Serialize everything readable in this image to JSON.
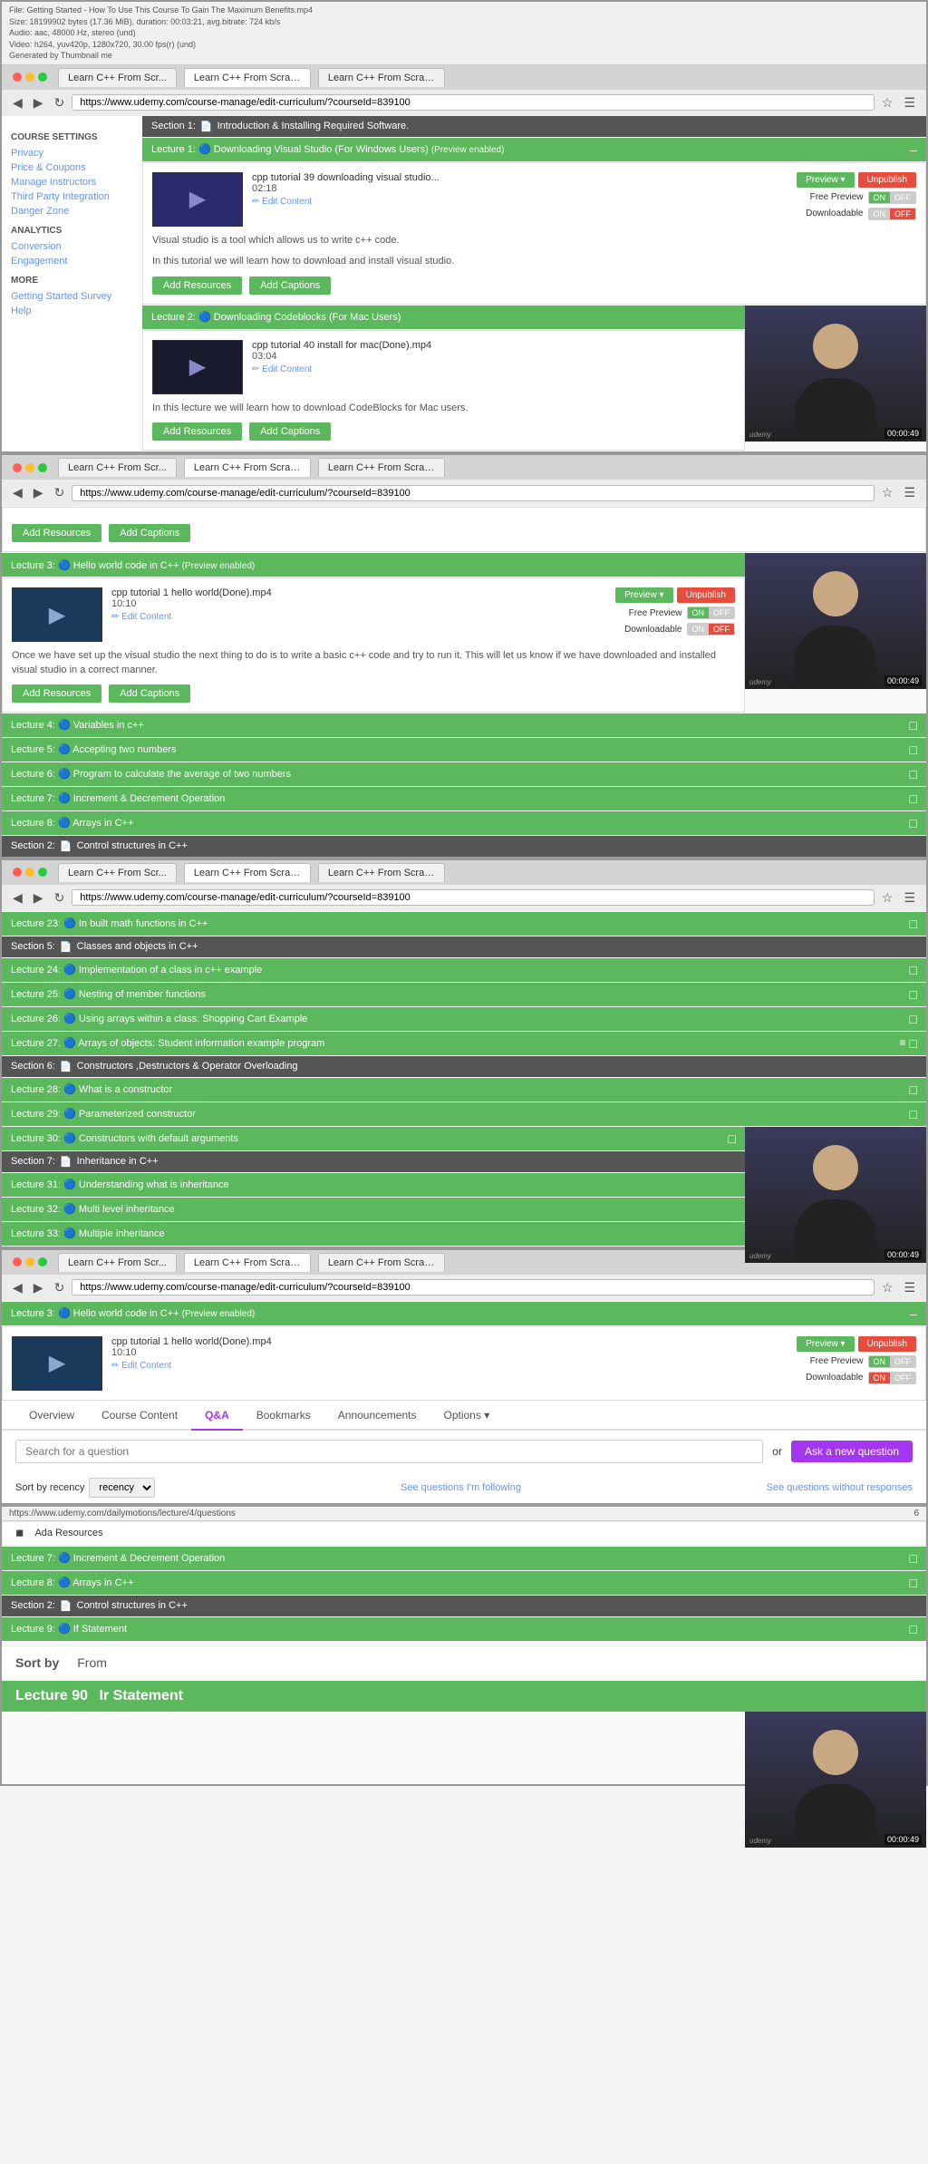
{
  "browser1": {
    "tabs": [
      {
        "label": "Learn C++ From Scr...",
        "active": false
      },
      {
        "label": "Learn C++ From Scratch",
        "active": true
      },
      {
        "label": "Learn C++ From Scratch...",
        "active": false
      }
    ],
    "url": "https://www.udemy.com/course-manage/edit-curriculum/?courseId=839100",
    "title_bar": "File: Getting Started - How To Use This Course To Gain The Maximum Benefits.mp4\nSize: 18199902 bytes (17.36 MiB), duration: 00:03:21, avg.bitrate: 724 kb/s\nAudio: aac, 48000 Hz, stereo (und)\nVideo: h264, yuv420p, 1280x720, 30.00 fps(r) (und)\nGenerated by Thumbnail me"
  },
  "sidebar": {
    "course_settings_title": "COURSE SETTINGS",
    "privacy_link": "Privacy",
    "price_coupons_link": "Price & Coupons",
    "manage_instructors_link": "Manage Instructors",
    "third_party_link": "Third Party Integration",
    "danger_zone_link": "Danger Zone",
    "analytics_title": "ANALYTICS",
    "conversion_link": "Conversion",
    "engagement_link": "Engagement",
    "more_title": "MORE",
    "getting_started_link": "Getting Started Survey",
    "help_link": "Help"
  },
  "section1": {
    "label": "Section 1:",
    "icon": "📄",
    "title": "Introduction & Installing Required Software.",
    "lectures": [
      {
        "number": "Lecture 1:",
        "icon": "🔵",
        "title": "Downloading Visual Studio (For Windows Users)",
        "badge": "(Preview enabled)",
        "filename": "cpp tutorial 39 downloading visual studio...",
        "duration": "02:18",
        "edit_label": "✏ Edit Content",
        "preview_label": "Preview ▾",
        "unpublish_label": "Unpublish",
        "free_preview": "Free Preview",
        "downloadable": "Downloadable",
        "toggle_on": "ON",
        "toggle_off": "OFF",
        "description1": "Visual studio is a tool which allows us to write c++ code.",
        "description2": "In this tutorial we will learn how to download and install visual studio.",
        "add_resources": "Add Resources",
        "add_captions": "Add Captions"
      },
      {
        "number": "Lecture 2:",
        "icon": "🔵",
        "title": "Downloading Codeblocks (For Mac Users)",
        "filename": "cpp tutorial 40 install for mac(Done).mp4",
        "duration": "03:04",
        "edit_label": "✏ Edit Content",
        "description1": "In this lecture we will learn how to download CodeBlocks for Mac users.",
        "add_resources": "Add Resources",
        "add_captions": "Add Captions"
      }
    ]
  },
  "section1_cont": {
    "add_resources": "Add Resources",
    "add_captions": "Add Captions",
    "lecture3": {
      "number": "Lecture 3:",
      "icon": "🔵",
      "title": "Hello world code in C++",
      "badge": "(Preview enabled)",
      "filename": "cpp tutorial 1 hello world(Done).mp4",
      "duration": "10:10",
      "edit_label": "✏ Edit Content",
      "preview_label": "Preview ▾",
      "unpublish_label": "Unpublish",
      "free_preview": "Free Preview",
      "downloadable": "Downloadable",
      "description": "Once we have set up the visual studio the next thing to do is to write a basic c++ code and try to run it. This will let us know if we have downloaded and installed visual studio in a correct manner.",
      "add_resources": "Add Resources",
      "add_captions": "Add Captions"
    },
    "lectures_collapsed": [
      {
        "number": "Lecture 4:",
        "icon": "🔵",
        "title": "Variables in c++"
      },
      {
        "number": "Lecture 5:",
        "icon": "🔵",
        "title": "Accepting two numbers"
      },
      {
        "number": "Lecture 6:",
        "icon": "🔵",
        "title": "Program to calculate the average of two numbers"
      },
      {
        "number": "Lecture 7:",
        "icon": "🔵",
        "title": "Increment & Decrement Operation"
      },
      {
        "number": "Lecture 8:",
        "icon": "🔵",
        "title": "Arrays in C++"
      }
    ],
    "section2": {
      "label": "Section 2:",
      "icon": "📄",
      "title": "Control structures in C++"
    }
  },
  "browser3": {
    "lectures_top": [
      {
        "number": "Lecture 23:",
        "icon": "🔵",
        "title": "In built math functions in C++"
      }
    ],
    "section5": {
      "label": "Section 5:",
      "icon": "📄",
      "title": "Classes and objects in C++"
    },
    "lectures5": [
      {
        "number": "Lecture 24:",
        "icon": "🔵",
        "title": "Implementation of a class in c++ example"
      },
      {
        "number": "Lecture 25:",
        "icon": "🔵",
        "title": "Nesting of member functions"
      },
      {
        "number": "Lecture 26:",
        "icon": "🔵",
        "title": "Using arrays within a class: Shopping Cart Example"
      },
      {
        "number": "Lecture 27:",
        "icon": "🔵",
        "title": "Arrays of objects: Student information example program"
      }
    ],
    "section6": {
      "label": "Section 6:",
      "icon": "📄",
      "title": "Constructors ,Destructors & Operator Overloading"
    },
    "lectures6": [
      {
        "number": "Lecture 28:",
        "icon": "🔵",
        "title": "What is a constructor"
      },
      {
        "number": "Lecture 29:",
        "icon": "🔵",
        "title": "Parameterized constructor"
      },
      {
        "number": "Lecture 30:",
        "icon": "🔵",
        "title": "Constructors with default arguments"
      }
    ],
    "section7": {
      "label": "Section 7:",
      "icon": "📄",
      "title": "Inheritance in C++"
    },
    "lectures7": [
      {
        "number": "Lecture 31:",
        "icon": "🔵",
        "title": "Understanding what is inheritance"
      },
      {
        "number": "Lecture 32:",
        "icon": "🔵",
        "title": "Multi level inheritance"
      },
      {
        "number": "Lecture 33:",
        "icon": "🔵",
        "title": "Multiple inheritance"
      }
    ]
  },
  "browser4": {
    "lecture3_expanded": {
      "number": "Lecture 3:",
      "icon": "🔵",
      "title": "Hello world code in C++",
      "badge": "(Preview enabled)",
      "filename": "cpp tutorial 1 hello world(Done).mp4",
      "duration": "10:10",
      "edit_label": "✏ Edit Content",
      "preview_label": "Preview ▾",
      "unpublish_label": "Unpublish",
      "free_preview": "Free Preview",
      "downloadable": "Downloadable"
    },
    "tabs": {
      "overview": "Overview",
      "course_content": "Course Content",
      "qa": "Q&A",
      "bookmarks": "Bookmarks",
      "announcements": "Announcements",
      "options": "Options ▾"
    },
    "qa": {
      "search_placeholder": "Search for a question",
      "or_text": "or",
      "ask_button": "Ask a new question",
      "sort_label": "Sort by recency",
      "following_link": "See questions I'm following",
      "no_response_link": "See questions without responses"
    }
  },
  "browser5": {
    "status_url": "https://www.udemy.com/dailymotions/lecture/4/questions",
    "number": "6",
    "lectures_bottom": [
      {
        "number": "Lecture 7:",
        "icon": "🔵",
        "title": "Increment & Decrement Operation"
      },
      {
        "number": "Lecture 8:",
        "icon": "🔵",
        "title": "Arrays in C++"
      }
    ],
    "section2": {
      "label": "Section 2:",
      "icon": "📄",
      "title": "Control structures in C++"
    },
    "lecture_if": {
      "number": "Lecture 9:",
      "icon": "🔵",
      "title": "If Statement"
    },
    "sort_by": "Sort by",
    "from_label": "From",
    "lecture_ir": {
      "number": "Lecture 90",
      "title": "Ir Statement"
    }
  },
  "ada_resources": {
    "label": "Ada Resources"
  },
  "preview_label": "Preview ~"
}
